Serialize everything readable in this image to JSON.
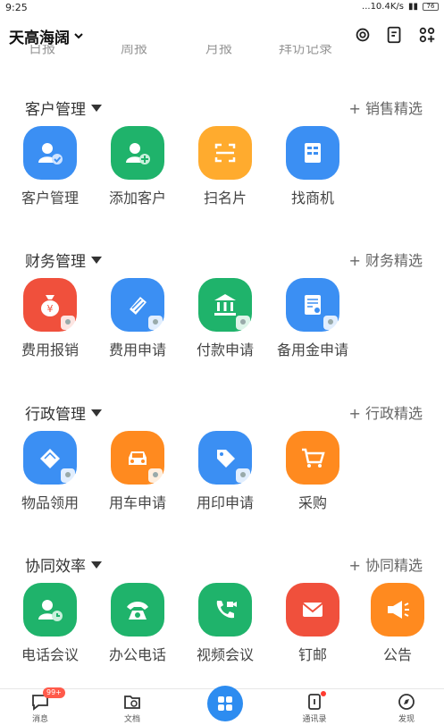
{
  "status": {
    "time": "9:25",
    "net": "...10.4K/s",
    "battery": "76"
  },
  "header": {
    "org_name": "天高海阔"
  },
  "prev_row": [
    "日报",
    "周报",
    "月报",
    "拜访记录"
  ],
  "sections": [
    {
      "title": "客户管理",
      "link": "+ 销售精选",
      "apps": [
        {
          "label": "客户管理",
          "color": "#3b8ff3",
          "icon": "customer-manage-icon"
        },
        {
          "label": "添加客户",
          "color": "#1fb36b",
          "icon": "add-customer-icon"
        },
        {
          "label": "扫名片",
          "color": "#ffab2e",
          "icon": "scan-card-icon"
        },
        {
          "label": "找商机",
          "color": "#3b8ff3",
          "icon": "find-opportunity-icon"
        }
      ]
    },
    {
      "title": "财务管理",
      "link": "+ 财务精选",
      "apps": [
        {
          "label": "费用报销",
          "color": "#f0503c",
          "icon": "money-bag-icon"
        },
        {
          "label": "费用申请",
          "color": "#3b8ff3",
          "icon": "pen-icon"
        },
        {
          "label": "付款申请",
          "color": "#1fb36b",
          "icon": "bank-icon"
        },
        {
          "label": "备用金申请",
          "color": "#3b8ff3",
          "icon": "certificate-icon"
        }
      ]
    },
    {
      "title": "行政管理",
      "link": "+ 行政精选",
      "apps": [
        {
          "label": "物品领用",
          "color": "#3b8ff3",
          "icon": "item-icon"
        },
        {
          "label": "用车申请",
          "color": "#ff8a1f",
          "icon": "car-icon"
        },
        {
          "label": "用印申请",
          "color": "#3b8ff3",
          "icon": "seal-icon"
        },
        {
          "label": "采购",
          "color": "#ff8a1f",
          "icon": "cart-icon"
        }
      ]
    },
    {
      "title": "协同效率",
      "link": "+ 协同精选",
      "apps": [
        {
          "label": "电话会议",
          "color": "#1fb36b",
          "icon": "phone-meeting-icon"
        },
        {
          "label": "办公电话",
          "color": "#1fb36b",
          "icon": "office-phone-icon"
        },
        {
          "label": "视频会议",
          "color": "#1fb36b",
          "icon": "video-meeting-icon"
        },
        {
          "label": "钉邮",
          "color": "#f0503c",
          "icon": "mail-icon"
        },
        {
          "label": "公告",
          "color": "#ff8a1f",
          "icon": "announcement-icon"
        }
      ]
    }
  ],
  "tabbar": {
    "messages": "消息",
    "unread": "99+",
    "docs": "文档",
    "contacts": "通讯录",
    "discover": "发现"
  }
}
